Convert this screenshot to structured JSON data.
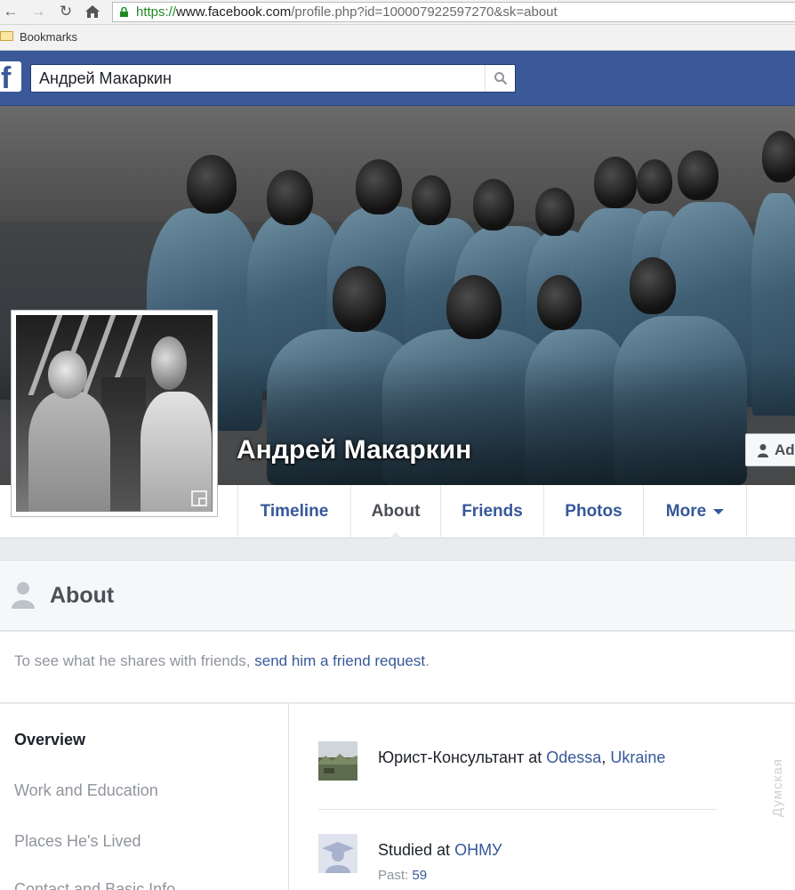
{
  "browser": {
    "url_scheme": "https://",
    "url_host": "www.facebook.com",
    "url_path": "/profile.php?id=100007922597270&sk=about",
    "bookmarks_label": "Bookmarks"
  },
  "header": {
    "search_value": "Андрей Макаркин"
  },
  "profile": {
    "name": "Андрей Макаркин",
    "add_friend_label": "Ad"
  },
  "tabs": [
    {
      "label": "Timeline",
      "active": false
    },
    {
      "label": "About",
      "active": true
    },
    {
      "label": "Friends",
      "active": false
    },
    {
      "label": "Photos",
      "active": false
    },
    {
      "label": "More",
      "active": false
    }
  ],
  "about": {
    "title": "About",
    "notice_prefix": "To see what he shares with friends, ",
    "notice_link": "send him a friend request",
    "notice_suffix": ".",
    "sidebar": [
      {
        "label": "Overview",
        "active": true
      },
      {
        "label": "Work and Education",
        "active": false
      },
      {
        "label": "Places He's Lived",
        "active": false
      },
      {
        "label": "Contact and Basic Info",
        "active": false
      }
    ],
    "work": {
      "text_prefix": "Юрист-Консультант at ",
      "city": "Odessa",
      "separator": ", ",
      "country": "Ukraine"
    },
    "education": {
      "text_prefix": "Studied at ",
      "school": "ОНМУ",
      "past_label": "Past: ",
      "past_value": "59"
    }
  },
  "watermark": "Думская",
  "colors": {
    "fb_blue": "#3b5998",
    "link_blue": "#365899",
    "muted_text": "#90949c"
  }
}
